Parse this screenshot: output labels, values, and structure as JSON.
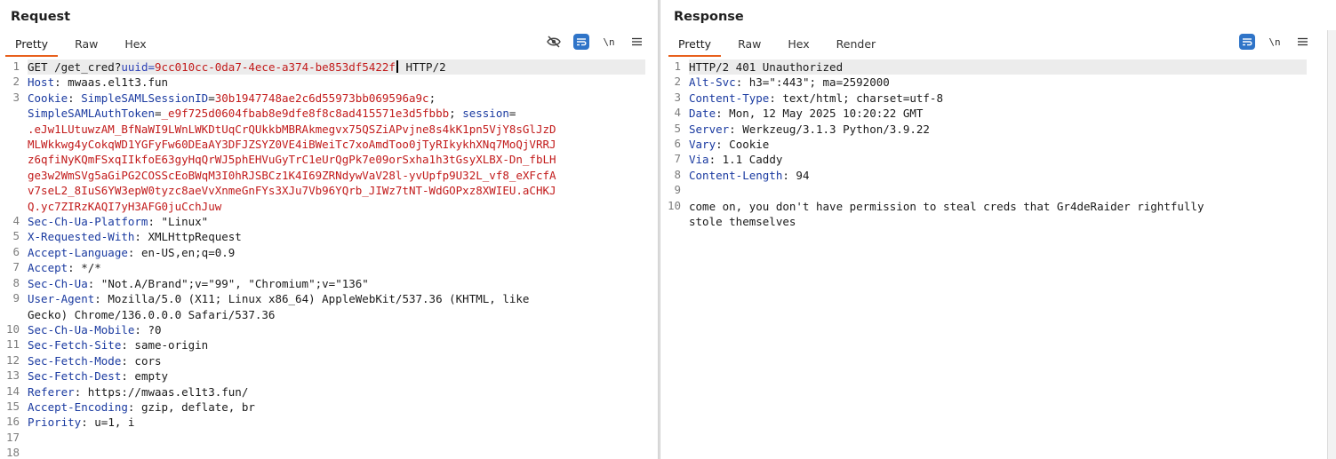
{
  "request": {
    "title": "Request",
    "tabs": [
      "Pretty",
      "Raw",
      "Hex"
    ],
    "active_tab": "Pretty",
    "toolbar": [
      "hide-icon",
      "wrap-icon",
      "newline-icon",
      "menu-icon"
    ],
    "lines": [
      {
        "n": "1",
        "method": "GET",
        "path": " /get_cred?",
        "qname": "uuid",
        "qeq": "=",
        "qval": "9cc010cc-0da7-4ece-a374-be853df5422f",
        "proto": " HTTP/2"
      },
      {
        "n": "2",
        "name": "Host",
        "value": " mwaas.el1t3.fun"
      },
      {
        "n": "3",
        "cookie": true
      },
      {
        "n": "4",
        "name": "Sec-Ch-Ua-Platform",
        "value": " \"Linux\""
      },
      {
        "n": "5",
        "name": "X-Requested-With",
        "value": " XMLHttpRequest"
      },
      {
        "n": "6",
        "name": "Accept-Language",
        "value": " en-US,en;q=0.9"
      },
      {
        "n": "7",
        "name": "Accept",
        "value": " */*"
      },
      {
        "n": "8",
        "name": "Sec-Ch-Ua",
        "value": " \"Not.A/Brand\";v=\"99\", \"Chromium\";v=\"136\""
      },
      {
        "n": "9",
        "name": "User-Agent",
        "value": " Mozilla/5.0 (X11; Linux x86_64) AppleWebKit/537.36 (KHTML, like\nGecko) Chrome/136.0.0.0 Safari/537.36"
      },
      {
        "n": "10",
        "name": "Sec-Ch-Ua-Mobile",
        "value": " ?0"
      },
      {
        "n": "11",
        "name": "Sec-Fetch-Site",
        "value": " same-origin"
      },
      {
        "n": "12",
        "name": "Sec-Fetch-Mode",
        "value": " cors"
      },
      {
        "n": "13",
        "name": "Sec-Fetch-Dest",
        "value": " empty"
      },
      {
        "n": "14",
        "name": "Referer",
        "value": " https://mwaas.el1t3.fun/"
      },
      {
        "n": "15",
        "name": "Accept-Encoding",
        "value": " gzip, deflate, br"
      },
      {
        "n": "16",
        "name": "Priority",
        "value": " u=1, i"
      },
      {
        "n": "17",
        "plain": ""
      },
      {
        "n": "18",
        "plain": ""
      }
    ],
    "cookie": {
      "header": "Cookie",
      "c1_name": "SimpleSAMLSessionID",
      "c1_val": "30b1947748ae2c6d55973bb069596a9c",
      "c2_name": "SimpleSAMLAuthToken",
      "c2_val": "_e9f725d0604fbab8e9dfe8f8c8ad415571e3d5fbbb",
      "c3_name": "session",
      "c3_val": ".eJw1LUtuwzAM_BfNaWI9LWnLWKDtUqCrQUkkbMBRAkmegvx75QSZiAPvjne8s4kK1pn5VjY8sGlJzD\nMLWkkwg4yCokqWD1YGFyFw60DEaAY3DFJZSYZ0VE4iBWeiTc7xoAmdToo0jTyRIkykhXNq7MoQjVRRJ\nz6qfiNyKQmFSxqIIkfoE63gyHqQrWJ5phEHVuGyTrC1eUrQgPk7e09orSxha1h3tGsyXLBX-Dn_fbLH\nge3w2WmSVg5aGiPG2COSScEoBWqM3I0hRJSBCz1K4I69ZRNdywVaV28l-yvUpfp9U32L_vf8_eXFcfA\nv7seL2_8IuS6YW3epW0tyzc8aeVvXnmeGnFYs3XJu7Vb96YQrb_JIWz7tNT-WdGOPxz8XWIEU.aCHKJ\nQ.yc7ZIRzKAQI7yH3AFG0juCchJuw"
    }
  },
  "response": {
    "title": "Response",
    "tabs": [
      "Pretty",
      "Raw",
      "Hex",
      "Render"
    ],
    "active_tab": "Pretty",
    "toolbar": [
      "wrap-icon",
      "newline-icon",
      "menu-icon"
    ],
    "lines": [
      {
        "n": "1",
        "plain": "HTTP/2 401 Unauthorized"
      },
      {
        "n": "2",
        "name": "Alt-Svc",
        "value": " h3=\":443\"; ma=2592000"
      },
      {
        "n": "3",
        "name": "Content-Type",
        "value": " text/html; charset=utf-8"
      },
      {
        "n": "4",
        "name": "Date",
        "value": " Mon, 12 May 2025 10:20:22 GMT"
      },
      {
        "n": "5",
        "name": "Server",
        "value": " Werkzeug/3.1.3 Python/3.9.22"
      },
      {
        "n": "6",
        "name": "Vary",
        "value": " Cookie"
      },
      {
        "n": "7",
        "name": "Via",
        "value": " 1.1 Caddy"
      },
      {
        "n": "8",
        "name": "Content-Length",
        "value": " 94"
      },
      {
        "n": "9",
        "plain": ""
      },
      {
        "n": "10",
        "plain": "come on, you don't have permission to steal creds that Gr4deRaider rightfully\nstole themselves"
      }
    ]
  }
}
